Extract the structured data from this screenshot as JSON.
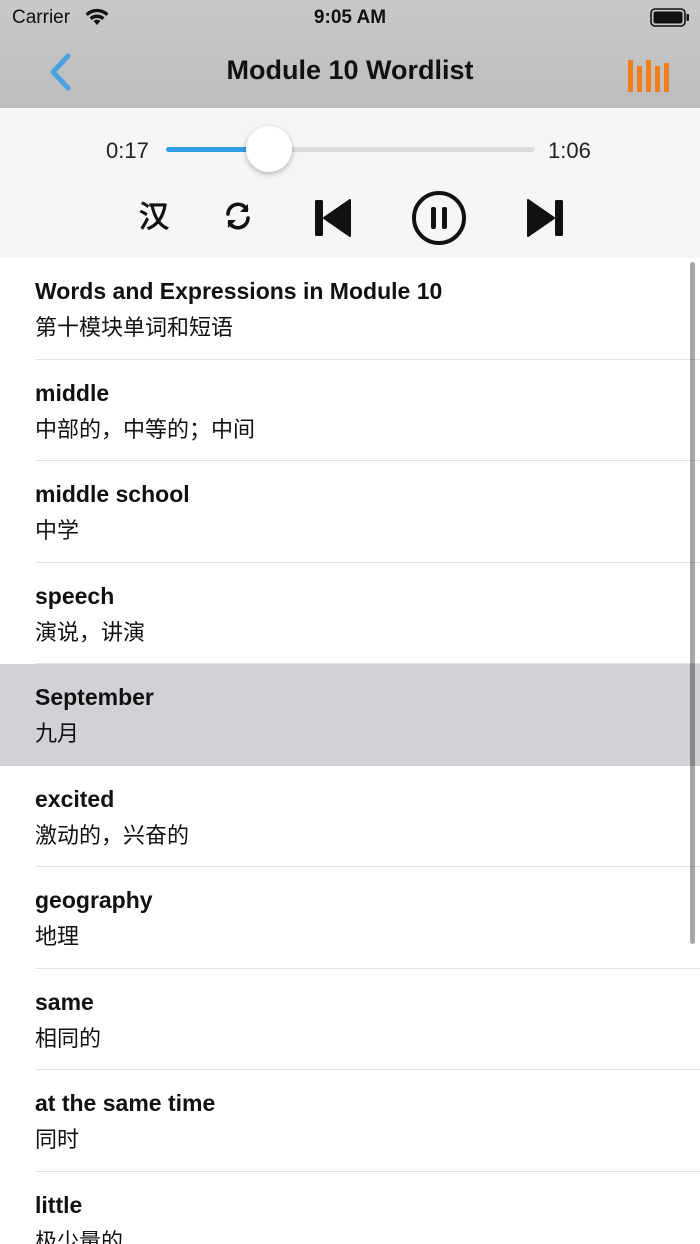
{
  "status": {
    "carrier": "Carrier",
    "time": "9:05 AM"
  },
  "nav": {
    "title": "Module 10 Wordlist",
    "back_icon": "chevron-left-icon",
    "list_icon": "bars-icon",
    "accent_color": "#4aa3df",
    "bars_color": "#f0801a"
  },
  "player": {
    "current_time": "0:17",
    "total_time": "1:06",
    "progress": 0.28,
    "lang_toggle": "汉",
    "progress_color": "#2f9fe6"
  },
  "words": [
    {
      "en": "Words and Expressions in Module 10",
      "zh": "第十模块单词和短语",
      "selected": false
    },
    {
      "en": "middle",
      "zh": "中部的，中等的；中间",
      "selected": false
    },
    {
      "en": "middle school",
      "zh": "中学",
      "selected": false
    },
    {
      "en": "speech",
      "zh": "演说，讲演",
      "selected": false
    },
    {
      "en": "September",
      "zh": "九月",
      "selected": true
    },
    {
      "en": "excited",
      "zh": "激动的，兴奋的",
      "selected": false
    },
    {
      "en": "geography",
      "zh": "地理",
      "selected": false
    },
    {
      "en": "same",
      "zh": "相同的",
      "selected": false
    },
    {
      "en": "at the same time",
      "zh": "同时",
      "selected": false
    },
    {
      "en": "little",
      "zh": "极少量的",
      "selected": false
    }
  ]
}
